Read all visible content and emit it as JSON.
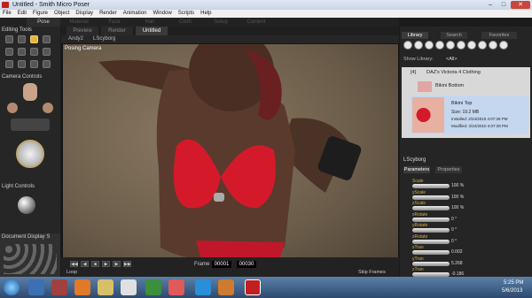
{
  "window": {
    "title": "Untitled - Smith Micro Poser"
  },
  "menu": [
    "File",
    "Edit",
    "Figure",
    "Object",
    "Display",
    "Render",
    "Animation",
    "Window",
    "Scripts",
    "Help"
  ],
  "rooms": [
    "Pose",
    "Material",
    "Face",
    "Hair",
    "Cloth",
    "Setup",
    "Content"
  ],
  "editing_tools": {
    "label": "Editing Tools"
  },
  "camera_controls": {
    "label": "Camera Controls"
  },
  "light_controls": {
    "label": "Light Controls"
  },
  "document_display": {
    "label": "Document Display S"
  },
  "viewport": {
    "tabs": [
      "Preview",
      "Render",
      "Untitled"
    ],
    "figure_select": "Andy2",
    "element_select": "LScyborg",
    "camera_label": "Posing Camera"
  },
  "timeline": {
    "frame_label": "Frame",
    "current_frame": "00001",
    "total_frames": "00030",
    "loop_label": "Loop",
    "skip_frames_label": "Skip Frames"
  },
  "library": {
    "tabs": [
      "Library",
      "Search",
      "Favorites"
    ],
    "show_label": "Show Library:",
    "show_value": "<All>",
    "folder": "DAZ's Victoria 4 Clothing",
    "folder_count": "[4]",
    "items": [
      "Bikini Bottom",
      "Bikini Top"
    ],
    "selected": {
      "name": "Bikini Top",
      "size": "Size: 19.2 MB",
      "installed": "Installed: 2/24/2010 4:07:28 PM",
      "modified": "Modified: 2/24/2010 4:07:28 PM"
    }
  },
  "params": {
    "object": "LScyborg",
    "tabs": [
      "Parameters",
      "Properties"
    ],
    "list": [
      {
        "name": "Scale",
        "value": "100 %"
      },
      {
        "name": "yScale",
        "value": "100 %"
      },
      {
        "name": "zScale",
        "value": "100 %"
      },
      {
        "name": "xRotate",
        "value": "0 °"
      },
      {
        "name": "yRotate",
        "value": "0 °"
      },
      {
        "name": "zRotate",
        "value": "0 °"
      },
      {
        "name": "xTran",
        "value": "0.002"
      },
      {
        "name": "yTran",
        "value": "5.268"
      },
      {
        "name": "zTran",
        "value": "-0.186"
      }
    ]
  },
  "taskbar": {
    "time": "5:25 PM",
    "date": "5/6/2013"
  },
  "colors": {
    "accent": "#e6b33c",
    "bikini": "#d41a2a",
    "library_highlight": "#c5d7ef"
  }
}
